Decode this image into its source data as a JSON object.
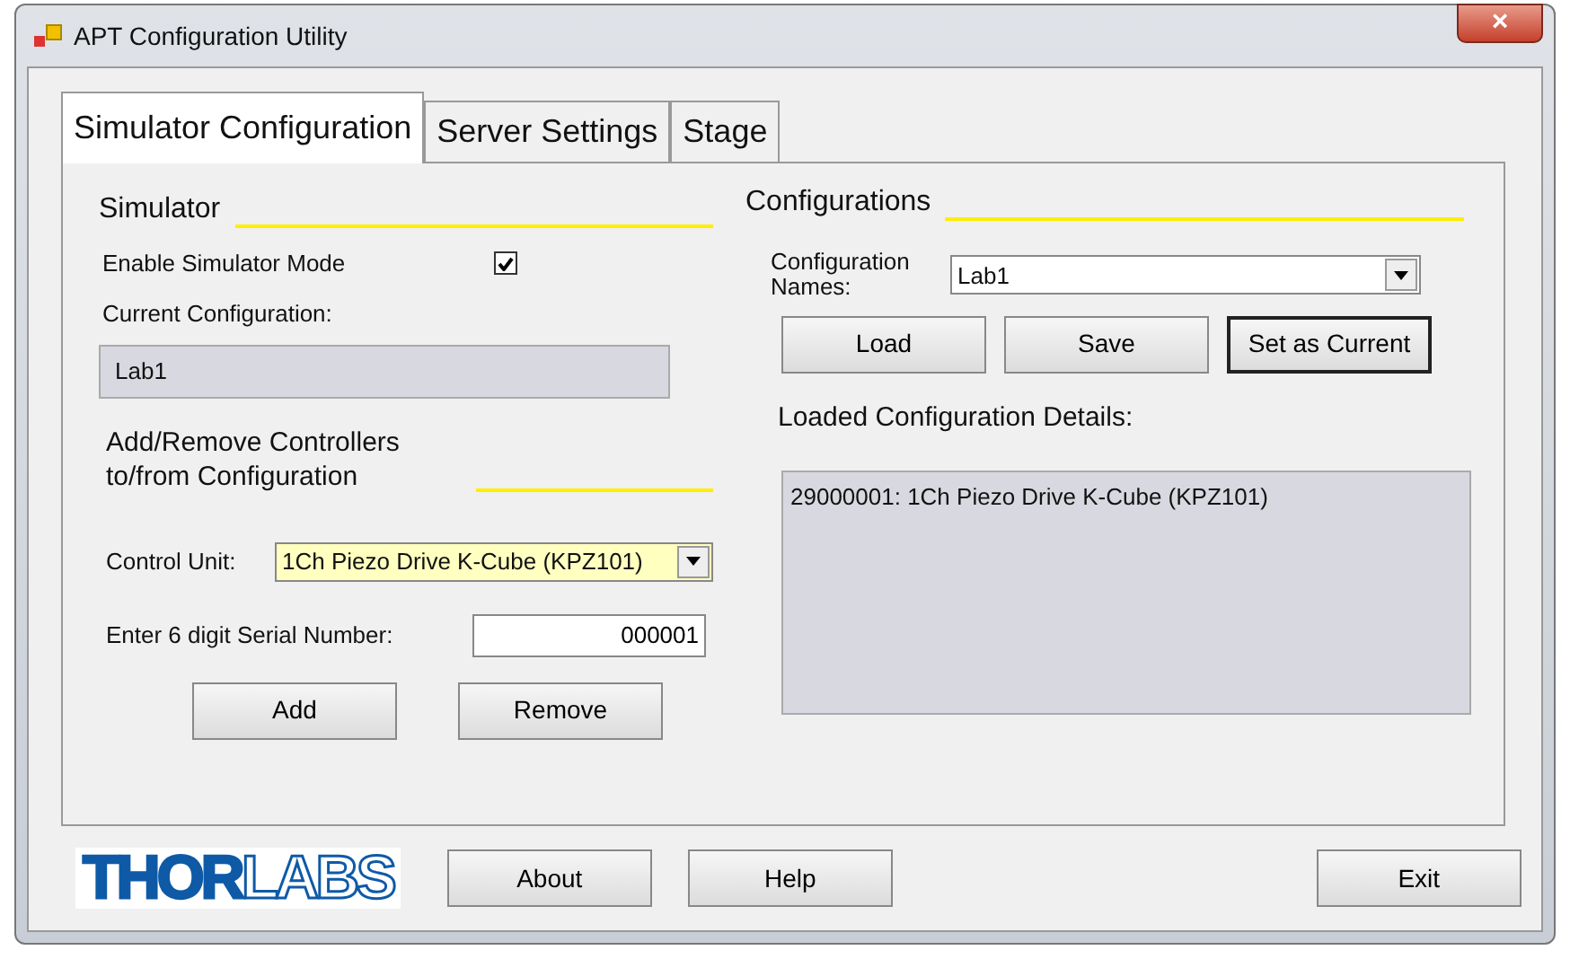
{
  "window": {
    "title": "APT Configuration Utility",
    "close": "×"
  },
  "tabs": [
    {
      "label": "Simulator Configuration",
      "selected": true
    },
    {
      "label": "Server Settings",
      "selected": false
    },
    {
      "label": "Stage",
      "selected": false
    }
  ],
  "simulator": {
    "heading": "Simulator",
    "enable_label": "Enable Simulator Mode",
    "enable_checked": true,
    "current_label": "Current Configuration:",
    "current_value": "Lab1"
  },
  "controllers": {
    "heading": "Add/Remove Controllers to/from Configuration",
    "unit_label": "Control Unit:",
    "unit_value": "1Ch Piezo Drive K-Cube (KPZ101)",
    "serial_label": "Enter 6 digit Serial Number:",
    "serial_value": "000001",
    "buttons": [
      {
        "label": "Add",
        "focused": false
      },
      {
        "label": "Remove",
        "focused": false
      }
    ]
  },
  "configurations": {
    "heading": "Configurations",
    "names_label": "Configuration Names:",
    "names_value": "Lab1",
    "buttons": [
      {
        "label": "Load",
        "focused": false
      },
      {
        "label": "Save",
        "focused": false
      },
      {
        "label": "Set as Current",
        "focused": true
      }
    ],
    "details_label": "Loaded Configuration Details:",
    "details": [
      "29000001: 1Ch Piezo Drive K-Cube (KPZ101)"
    ]
  },
  "footer": {
    "logo": "**THOR**LABS",
    "buttons": [
      "About",
      "Help",
      "Exit"
    ]
  }
}
